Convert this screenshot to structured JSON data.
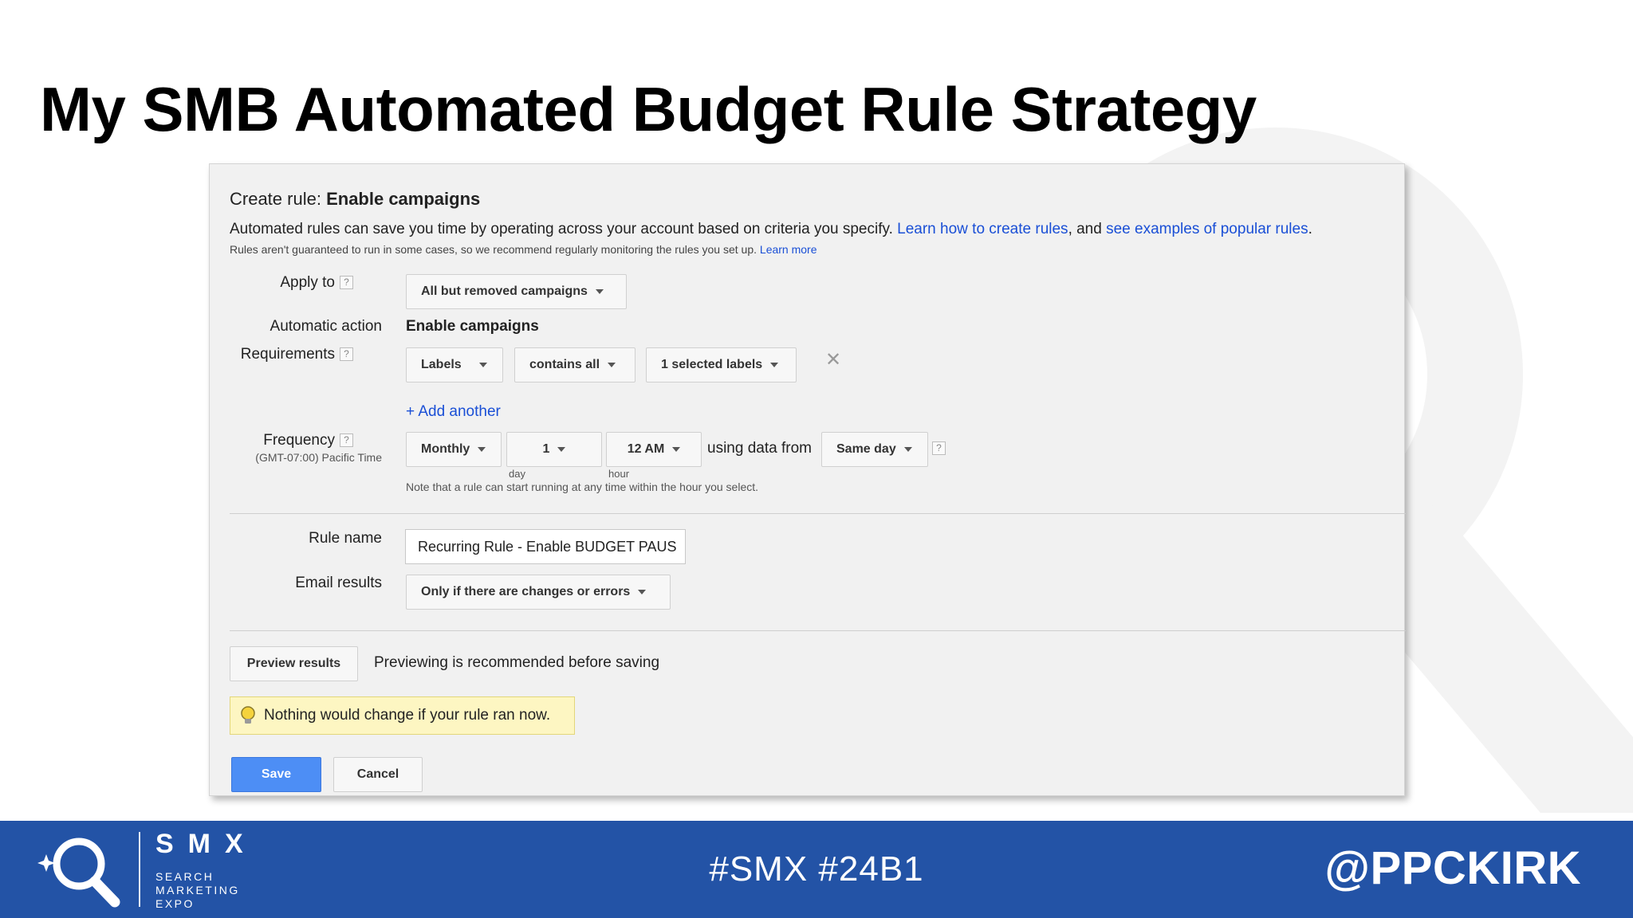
{
  "slide": {
    "title": "My SMB Automated Budget Rule Strategy"
  },
  "rule": {
    "title_prefix": "Create rule:",
    "title_strong": "Enable campaigns",
    "intro_text": "Automated rules can save you time by operating across your account based on criteria you specify.",
    "intro_link1": "Learn how to create rules",
    "intro_mid": ", and",
    "intro_link2": "see examples of popular rules",
    "intro_end": ".",
    "note_text": "Rules aren't guaranteed to run in some cases, so we recommend regularly monitoring the rules you set up.",
    "note_link": "Learn more",
    "apply_to": {
      "label": "Apply to",
      "value": "All but removed campaigns"
    },
    "automatic_action": {
      "label": "Automatic action",
      "value": "Enable campaigns"
    },
    "requirements": {
      "label": "Requirements",
      "field": "Labels",
      "operator": "contains all",
      "value": "1 selected labels",
      "add_another": "+ Add another"
    },
    "frequency": {
      "label": "Frequency",
      "timezone": "(GMT-07:00) Pacific Time",
      "period": "Monthly",
      "day": "1",
      "day_caption": "day",
      "hour": "12 AM",
      "hour_caption": "hour",
      "using_data_from": "using data from",
      "data_range": "Same day",
      "note": "Note that a rule can start running at any time within the hour you select."
    },
    "rule_name": {
      "label": "Rule name",
      "value": "Recurring Rule - Enable BUDGET PAUS"
    },
    "email_results": {
      "label": "Email results",
      "value": "Only if there are changes or errors"
    },
    "preview": {
      "button": "Preview results",
      "hint": "Previewing is recommended before saving",
      "notice": "Nothing would change if your rule ran now."
    },
    "actions": {
      "save": "Save",
      "cancel": "Cancel"
    },
    "help_glyph": "?",
    "remove_glyph": "✕"
  },
  "footer": {
    "brand": "SMX",
    "brand_sub_1": "SEARCH",
    "brand_sub_2": "MARKETING",
    "brand_sub_3": "EXPO",
    "hashtag": "#SMX #24B1",
    "handle": "@PPCKIRK"
  },
  "colors": {
    "footer_bg": "#2353a6",
    "link": "#1a4fd6",
    "save_button": "#4d8ef5",
    "notice_bg": "#fdf6c2"
  },
  "icons": [
    "search-magnifier-icon",
    "help-icon",
    "close-icon",
    "chevron-down-icon",
    "lightbulb-icon"
  ]
}
